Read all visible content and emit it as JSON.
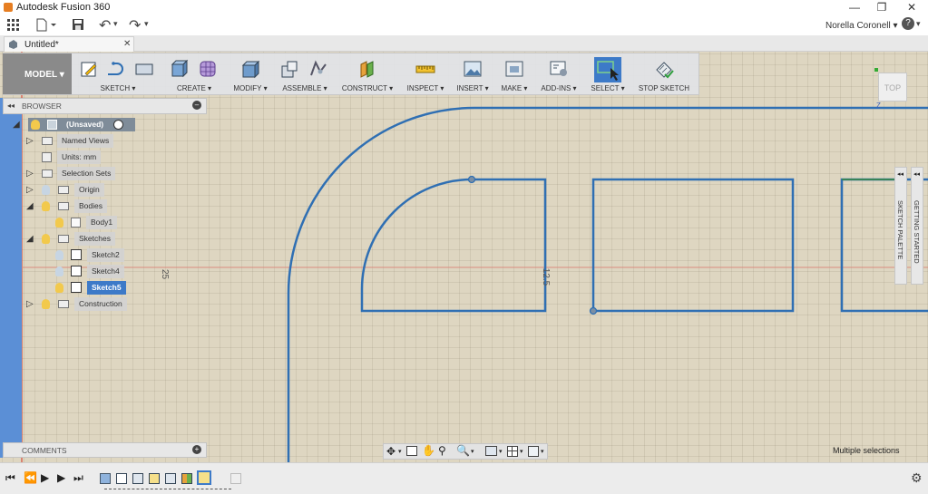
{
  "app": {
    "title": "Autodesk Fusion 360",
    "user": "Norella Coronell ▾"
  },
  "tab": {
    "title": "Untitled*",
    "close": "✕"
  },
  "quick": {
    "undo": "↶",
    "redo": "↷",
    "caret": "▾"
  },
  "toolbar": {
    "mode": "MODEL ▾",
    "groups": [
      {
        "label": "SKETCH ▾"
      },
      {
        "label": "CREATE ▾"
      },
      {
        "label": "MODIFY ▾"
      },
      {
        "label": "ASSEMBLE ▾"
      },
      {
        "label": "CONSTRUCT ▾"
      },
      {
        "label": "INSPECT ▾"
      },
      {
        "label": "INSERT ▾"
      },
      {
        "label": "MAKE ▾"
      },
      {
        "label": "ADD-INS ▾"
      },
      {
        "label": "SELECT ▾"
      },
      {
        "label": "STOP SKETCH"
      }
    ]
  },
  "browser": {
    "title": "BROWSER",
    "items": [
      {
        "label": "(Unsaved)"
      },
      {
        "label": "Named Views"
      },
      {
        "label": "Units: mm"
      },
      {
        "label": "Selection Sets"
      },
      {
        "label": "Origin"
      },
      {
        "label": "Bodies"
      },
      {
        "label": "Body1"
      },
      {
        "label": "Sketches"
      },
      {
        "label": "Sketch2"
      },
      {
        "label": "Sketch4"
      },
      {
        "label": "Sketch5"
      },
      {
        "label": "Construction"
      }
    ]
  },
  "comments": {
    "title": "COMMENTS"
  },
  "canvas": {
    "dim1": "25",
    "dim2": "12.5",
    "axis_label": "Z"
  },
  "viewcube": {
    "face": "TOP"
  },
  "palettes": {
    "sketch": "SKETCH PALETTE",
    "getting_started": "GETTING STARTED"
  },
  "status": {
    "text": "Multiple selections"
  },
  "colors": {
    "sketch_line": "#2f6fb3",
    "canvas_bg": "#ded6c1",
    "selected": "#3d7ac8"
  }
}
